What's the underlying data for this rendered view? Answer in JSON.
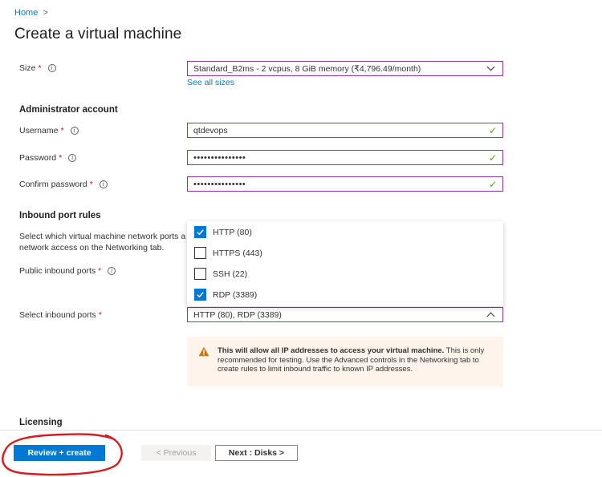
{
  "breadcrumb": {
    "home": "Home",
    "separator": ">"
  },
  "page_title": "Create a virtual machine",
  "size": {
    "label": "Size",
    "required": "*",
    "value": "Standard_B2ms - 2 vcpus, 8 GiB memory (₹4,796.49/month)",
    "see_all": "See all sizes"
  },
  "admin": {
    "section_title": "Administrator account",
    "username_label": "Username",
    "username_value": "qtdevops",
    "password_label": "Password",
    "password_value": "•••••••••••••••",
    "confirm_label": "Confirm password",
    "confirm_value": "•••••••••••••••",
    "required": "*"
  },
  "inbound": {
    "section_title": "Inbound port rules",
    "desc_line1": "Select which virtual machine network ports a",
    "desc_line2": "network access on the Networking tab.",
    "public_label": "Public inbound ports",
    "select_label": "Select inbound ports",
    "select_value": "HTTP (80), RDP (3389)",
    "required": "*",
    "options": [
      {
        "label": "HTTP (80)",
        "checked": true
      },
      {
        "label": "HTTPS (443)",
        "checked": false
      },
      {
        "label": "SSH (22)",
        "checked": false
      },
      {
        "label": "RDP (3389)",
        "checked": true
      }
    ]
  },
  "warning": {
    "bold": "This will allow all IP addresses to access your virtual machine.",
    "rest": " This is only recommended for testing.  Use the Advanced controls in the Networking tab to create rules to limit inbound traffic to known IP addresses."
  },
  "licensing": {
    "section_title": "Licensing"
  },
  "footer": {
    "review_create": "Review + create",
    "previous": "< Previous",
    "next": "Next : Disks >"
  },
  "colors": {
    "accent": "#0078d4",
    "field_border": "#8a3aa8",
    "valid_check": "#57a300",
    "warning_bg": "#fff4ec",
    "warning_icon": "#d47500",
    "annotation": "#d81b1b"
  }
}
